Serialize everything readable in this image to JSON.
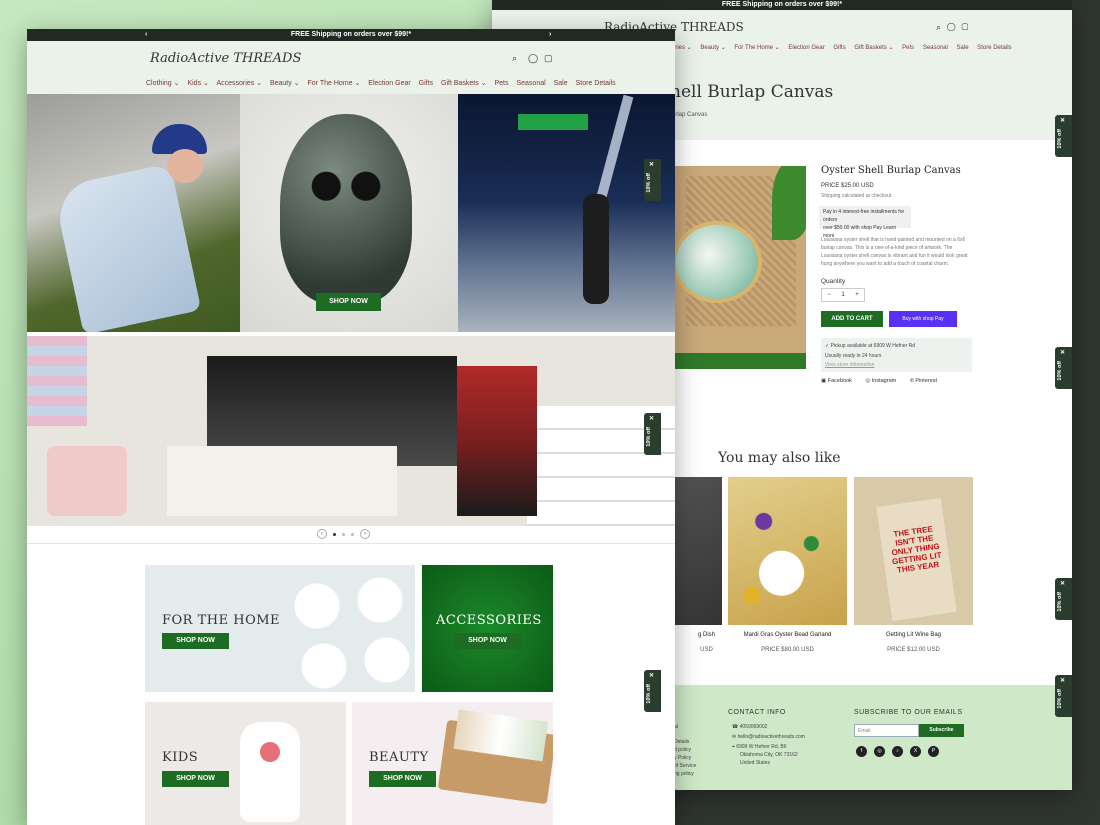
{
  "announcement": "FREE Shipping on orders over $99!*",
  "logo": "RadioActive THREADS",
  "nav": [
    "Clothing ⌄",
    "Kids ⌄",
    "Accessories ⌄",
    "Beauty ⌄",
    "For The Home ⌄",
    "Election Gear",
    "Gifts",
    "Gift Baskets ⌄",
    "Pets",
    "Seasonal",
    "Sale",
    "Store Details"
  ],
  "back_nav": [
    "ories ⌄",
    "Beauty ⌄",
    "For The Home ⌄",
    "Election Gear",
    "Gifts",
    "Gift Baskets ⌄",
    "Pets",
    "Seasonal",
    "Sale",
    "Store Details"
  ],
  "hero": {
    "shop_now": "SHOP NOW"
  },
  "discount_tab": "10% off",
  "tiles": {
    "home": {
      "label": "FOR THE HOME",
      "button": "SHOP NOW"
    },
    "accessories": {
      "label": "ACCESSORIES",
      "button": "SHOP NOW"
    },
    "kids": {
      "label": "KIDS",
      "button": "SHOP NOW"
    },
    "beauty": {
      "label": "BEAUTY",
      "button": "SHOP NOW"
    }
  },
  "product": {
    "page_title": "hell Burlap Canvas",
    "breadcrumb": "urlap Canvas",
    "name": "Oyster Shell Burlap Canvas",
    "price": "PRICE $25.00 USD",
    "shipping": "Shipping calculated at checkout",
    "shoppay_line1": "Pay in 4 interest-free installments for orders",
    "shoppay_line2": "over $50.00 with shop Pay  Learn more",
    "description": "Louisiana oyster shell that is hand painted and mounted on a 6x6 burlap canvas. This is a one-of-a-kind piece of artwork. The Louisiana oyster shell canvas is vibrant and fun it would look great hung anywhere you want to add a touch of coastal charm.",
    "quantity_label": "Quantity",
    "quantity_value": "1",
    "minus": "−",
    "plus": "+",
    "add_to_cart": "ADD TO CART",
    "buy_with": "Buy with shop Pay",
    "pickup_line1": "✓ Pickup available at 6909 W Hefner Rd",
    "pickup_line2": "Usually ready in 24 hours",
    "pickup_link": "View store information",
    "social": [
      "Facebook",
      "Instagram",
      "Pinterest"
    ]
  },
  "you_may_also_like": "You may also like",
  "related": [
    {
      "name": "g Dish",
      "price": "USD"
    },
    {
      "name": "Mardi Gras Oyster Bead Garland",
      "price": "PRICE $80.00 USD"
    },
    {
      "name": "Getting Lit Wine Bag",
      "price": "PRICE $12.00 USD",
      "bag_text": "THE TREE ISN'T THE ONLY THING GETTING LIT THIS YEAR"
    }
  ],
  "footer": {
    "left_links": [
      "al",
      "Details",
      "d policy",
      "y Policy",
      "of Service",
      "ng policy"
    ],
    "contact_heading": "CONTACT INFO",
    "phone": "4050069002",
    "email": "hello@radioactivethreads.com",
    "address": [
      "6909 W Hefner Rd, B6",
      "Oklahoma City, OK 73162",
      "United States"
    ],
    "subscribe_heading": "SUBSCRIBE TO OUR EMAILS",
    "email_placeholder": "Email",
    "subscribe_button": "Subscribe",
    "social_icons": [
      "f",
      "◎",
      "♪",
      "X",
      "P"
    ]
  }
}
